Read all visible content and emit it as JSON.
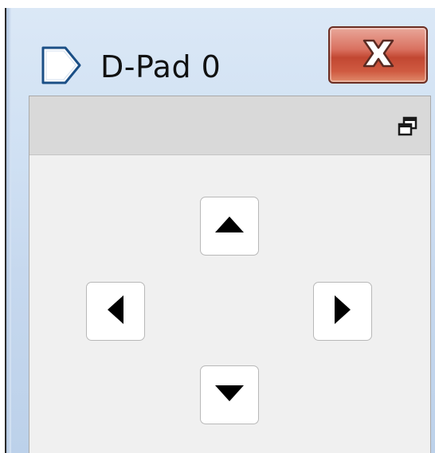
{
  "window": {
    "title": "D-Pad 0",
    "app_icon": "tag-icon",
    "close_icon": "close-icon"
  },
  "panel": {
    "restore_icon": "restore-window-icon"
  },
  "dpad": {
    "buttons": [
      {
        "direction": "up",
        "icon": "triangle-up-icon"
      },
      {
        "direction": "left",
        "icon": "triangle-left-icon"
      },
      {
        "direction": "right",
        "icon": "triangle-right-icon"
      },
      {
        "direction": "down",
        "icon": "triangle-down-icon"
      }
    ]
  },
  "colors": {
    "close_button": "#c24732",
    "client_background": "#f0f0f0",
    "panel_header": "#d9d9d9",
    "arrow": "#000000"
  }
}
